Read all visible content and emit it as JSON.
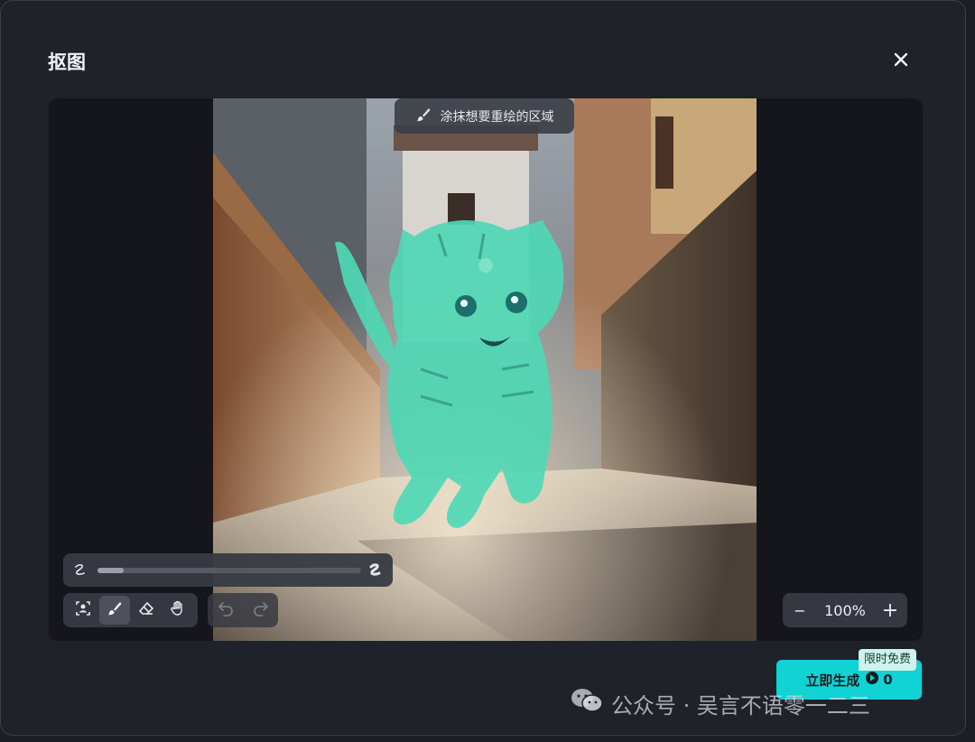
{
  "dialog": {
    "title": "抠图",
    "close_icon": "close-icon"
  },
  "canvas": {
    "hint_text": "涂抹想要重绘的区域",
    "hint_icon": "brush-icon"
  },
  "brush_size": {
    "min_icon": "brush-small-icon",
    "max_icon": "brush-large-icon",
    "value_fraction": 0.1
  },
  "tools": [
    {
      "name": "auto-select-icon",
      "active": false
    },
    {
      "name": "brush-icon",
      "active": true
    },
    {
      "name": "eraser-icon",
      "active": false
    },
    {
      "name": "hand-icon",
      "active": false
    }
  ],
  "history": {
    "undo_icon": "undo-icon",
    "redo_icon": "redo-icon"
  },
  "zoom": {
    "value": "100%",
    "minus": "−",
    "plus": "+"
  },
  "generate": {
    "label": "立即生成",
    "credits": "0",
    "badge": "限时免费"
  },
  "watermark": {
    "text": "公众号 · 吴言不语零一二三"
  },
  "colors": {
    "accent": "#11d3d3",
    "mask": "#4fd8b4"
  }
}
